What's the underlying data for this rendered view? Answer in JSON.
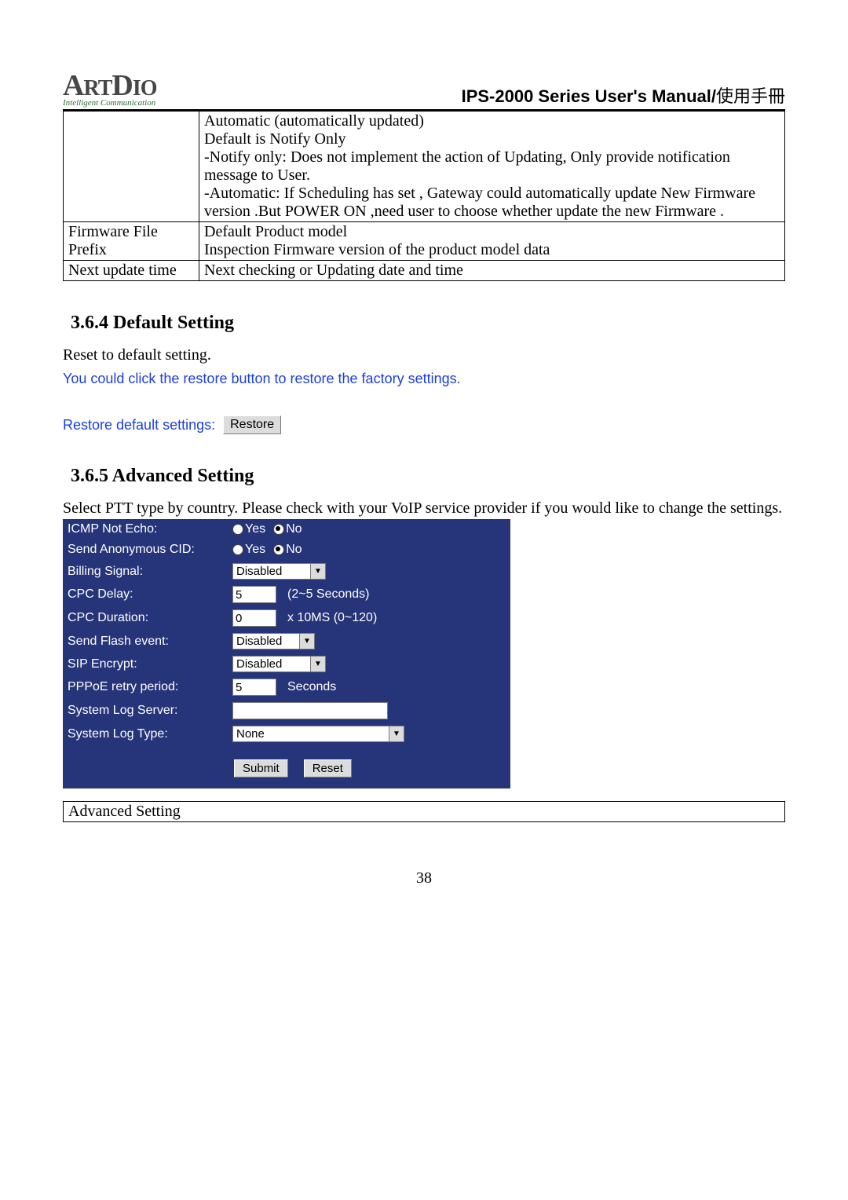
{
  "header": {
    "logo_main": "ArtDio",
    "logo_sub": "Intelligent Communication",
    "manual_title": "IPS-2000 Series User's Manual/",
    "manual_title_cjk": "使用手冊"
  },
  "spec_table": {
    "row0_desc": "Automatic (automatically updated)\nDefault is Notify Only\n-Notify only: Does not implement the action of Updating, Only provide notification message to User.\n-Automatic: If Scheduling has set , Gateway could automatically update New Firmware version .But POWER ON ,need user to choose whether update the new Firmware .",
    "row1_label": "Firmware File Prefix",
    "row1_desc": "Default Product model\nInspection Firmware version of the product model data",
    "row2_label": "Next update time",
    "row2_desc": "Next checking or Updating date and time"
  },
  "default_section": {
    "heading": "3.6.4 Default Setting",
    "intro": "Reset to default setting.",
    "help": "You could click the restore button to restore the factory settings.",
    "label": "Restore default settings:",
    "button": "Restore"
  },
  "advanced_section": {
    "heading": "3.6.5 Advanced Setting",
    "intro": "Select PTT type by country. Please check with your VoIP service provider if you would like to change the settings."
  },
  "form": {
    "icmp_label": "ICMP Not Echo:",
    "yes": "Yes",
    "no": "No",
    "send_anon_label": "Send Anonymous CID:",
    "billing_label": "Billing Signal:",
    "billing_value": "Disabled",
    "cpc_delay_label": "CPC Delay:",
    "cpc_delay_value": "5",
    "cpc_delay_suffix": "(2~5 Seconds)",
    "cpc_dur_label": "CPC Duration:",
    "cpc_dur_value": "0",
    "cpc_dur_suffix": "x 10MS (0~120)",
    "flash_label": "Send Flash event:",
    "flash_value": "Disabled",
    "sip_label": "SIP Encrypt:",
    "sip_value": "Disabled",
    "pppoe_label": "PPPoE retry period:",
    "pppoe_value": "5",
    "pppoe_suffix": "Seconds",
    "syslog_srv_label": "System Log Server:",
    "syslog_srv_value": "",
    "syslog_type_label": "System Log Type:",
    "syslog_type_value": "None",
    "submit": "Submit",
    "reset": "Reset"
  },
  "footer_table": {
    "cell": "Advanced Setting"
  },
  "page_number": "38"
}
